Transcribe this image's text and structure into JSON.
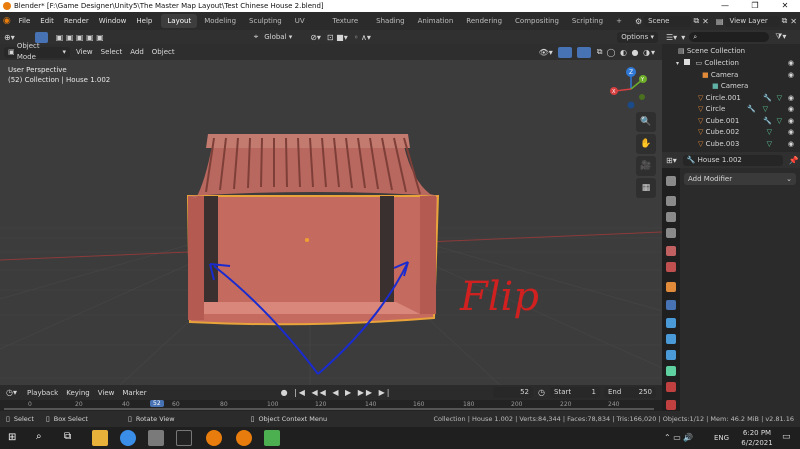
{
  "window": {
    "title": "Blender* [F:\\Game Designer\\Unity5\\The Master Map Layout\\Test Chinese House 2.blend]",
    "controls": [
      "—",
      "❐",
      "✕"
    ]
  },
  "menu": {
    "items": [
      "File",
      "Edit",
      "Render",
      "Window",
      "Help"
    ],
    "workspaces": [
      "Layout",
      "Modeling",
      "Sculpting",
      "UV Editing",
      "Texture Paint",
      "Shading",
      "Animation",
      "Rendering",
      "Compositing",
      "Scripting"
    ],
    "add_tab": "+",
    "scene": "Scene",
    "view_layer": "View Layer"
  },
  "header3d": {
    "transform_orientation": "Global",
    "options": "Options"
  },
  "toolbar3d": {
    "mode": "Object Mode",
    "menus": [
      "View",
      "Select",
      "Add",
      "Object"
    ]
  },
  "viewport": {
    "perspective": "User Perspective",
    "collection_info": "(52) Collection | House 1.002",
    "gizmo_axes": [
      "Z",
      "Y",
      "X"
    ],
    "annotation": "Flip"
  },
  "timeline": {
    "menus": [
      "Playback",
      "Keying",
      "View",
      "Marker"
    ],
    "current_frame": "52",
    "start_label": "Start",
    "start": "1",
    "end_label": "End",
    "end": "250",
    "ticks": [
      "0",
      "20",
      "40",
      "52",
      "60",
      "80",
      "100",
      "120",
      "140",
      "160",
      "180",
      "200",
      "220",
      "240"
    ]
  },
  "outliner": {
    "root": "Scene Collection",
    "items": [
      {
        "name": "Collection",
        "icon": "collection-icon",
        "depth": 1
      },
      {
        "name": "Camera",
        "icon": "camera-object-icon",
        "depth": 2
      },
      {
        "name": "Camera",
        "icon": "camera-data-icon",
        "depth": 3
      },
      {
        "name": "Circle.001",
        "icon": "mesh-icon",
        "depth": 2
      },
      {
        "name": "Circle",
        "icon": "mesh-icon",
        "depth": 2
      },
      {
        "name": "Cube.001",
        "icon": "mesh-icon",
        "depth": 2
      },
      {
        "name": "Cube.002",
        "icon": "mesh-icon",
        "depth": 2
      },
      {
        "name": "Cube.003",
        "icon": "mesh-icon",
        "depth": 2
      }
    ]
  },
  "properties": {
    "object_name": "House 1.002",
    "add_modifier": "Add Modifier"
  },
  "status": {
    "select": "Select",
    "box_select": "Box Select",
    "rotate_view": "Rotate View",
    "context_menu": "Object Context Menu",
    "stats": "Collection | House 1.002 | Verts:84,344 | Faces:78,834 | Tris:166,020 | Objects:1/12 | Mem: 46.2 MiB | v2.81.16"
  },
  "taskbar": {
    "language": "ENG",
    "time": "6:20 PM",
    "date": "6/2/2021"
  },
  "colors": {
    "accent": "#4772b3",
    "house_wall": "#c46a5e",
    "house_roof": "#b8685f",
    "selection": "#e8a33a",
    "annotation_blue": "#1a2bd0",
    "annotation_red": "#d02020"
  }
}
